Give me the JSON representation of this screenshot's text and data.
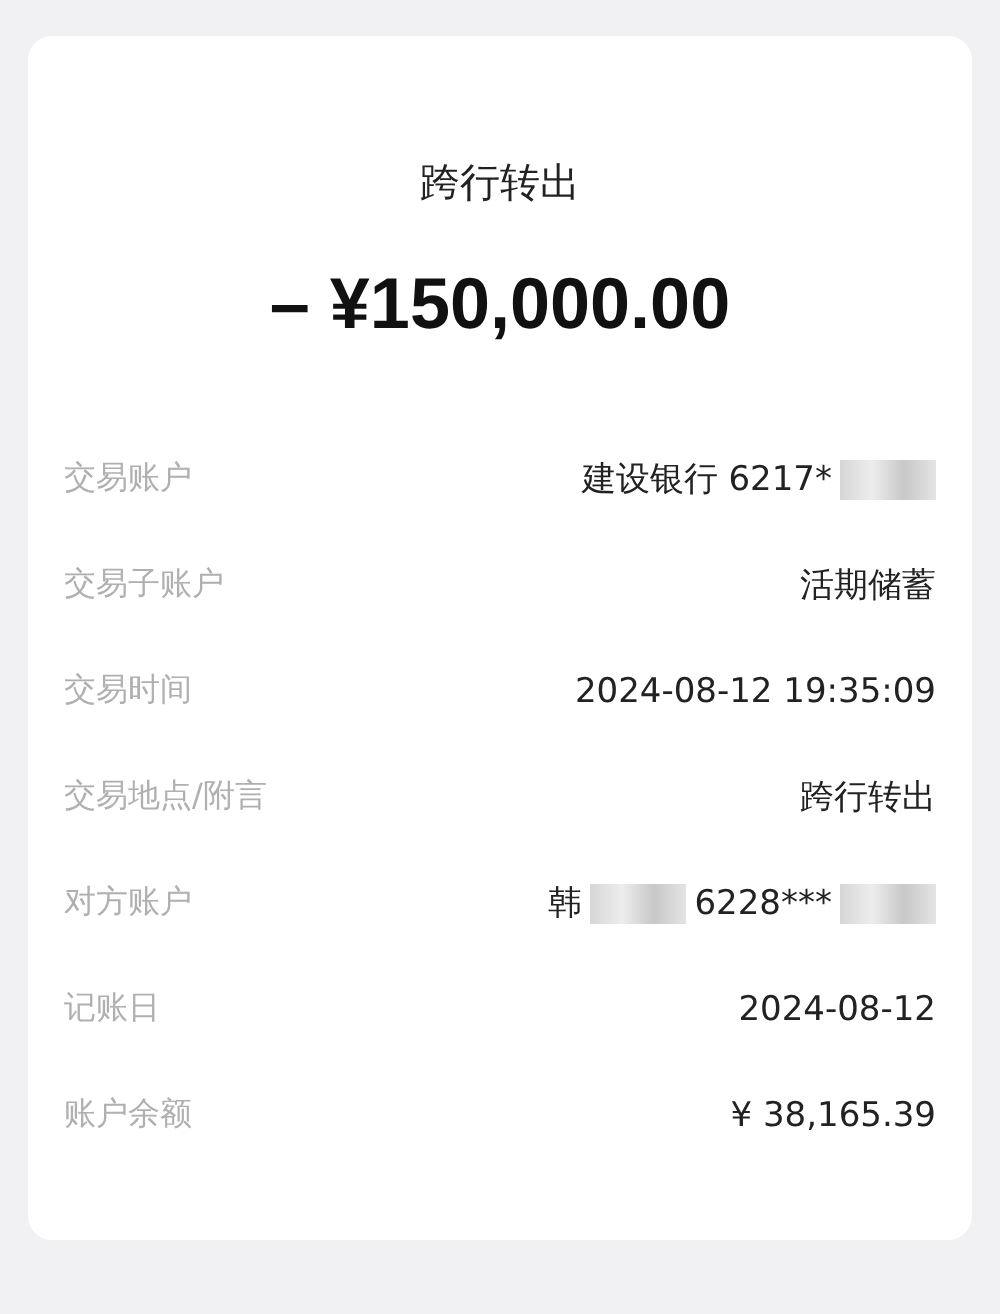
{
  "title": "跨行转出",
  "amount": "– ¥150,000.00",
  "rows": [
    {
      "label": "交易账户",
      "value": [
        {
          "kind": "text",
          "text": "建设银行 6217*"
        },
        {
          "kind": "redacted"
        }
      ]
    },
    {
      "label": "交易子账户",
      "value": [
        {
          "kind": "text",
          "text": "活期储蓄"
        }
      ]
    },
    {
      "label": "交易时间",
      "value": [
        {
          "kind": "text",
          "text": "2024-08-12 19:35:09"
        }
      ]
    },
    {
      "label": "交易地点/附言",
      "value": [
        {
          "kind": "text",
          "text": "跨行转出"
        }
      ]
    },
    {
      "label": "对方账户",
      "value": [
        {
          "kind": "text",
          "text": "韩"
        },
        {
          "kind": "redacted"
        },
        {
          "kind": "text",
          "text": "6228***"
        },
        {
          "kind": "redacted"
        }
      ]
    },
    {
      "label": "记账日",
      "value": [
        {
          "kind": "text",
          "text": "2024-08-12"
        }
      ]
    },
    {
      "label": "账户余额",
      "value": [
        {
          "kind": "text",
          "text": "¥ 38,165.39"
        }
      ]
    }
  ]
}
